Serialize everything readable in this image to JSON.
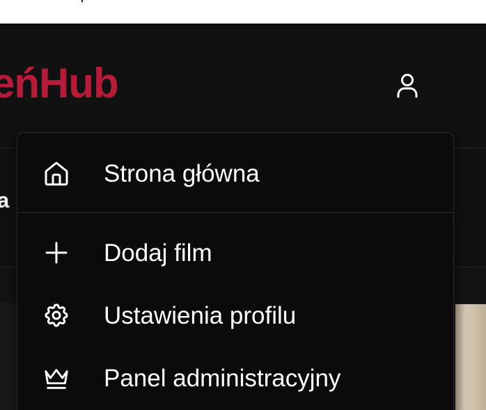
{
  "app": {
    "brand_visible": "eńHub",
    "brand_color": "#b81b3a",
    "user_icon": "user-icon"
  },
  "subnav": {
    "partial_text": "a"
  },
  "menu": {
    "items": [
      {
        "label": "Strona główna",
        "icon": "home-icon"
      },
      {
        "label": "Dodaj film",
        "icon": "plus-icon"
      },
      {
        "label": "Ustawienia profilu",
        "icon": "gear-icon"
      },
      {
        "label": "Panel administracyjny",
        "icon": "crown-icon"
      }
    ]
  }
}
